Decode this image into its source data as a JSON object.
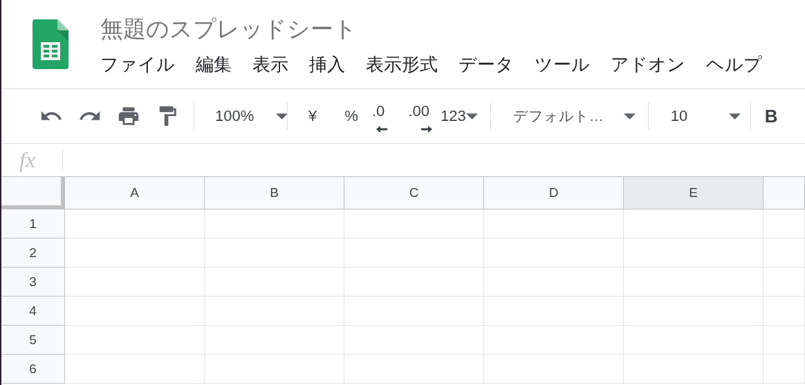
{
  "document": {
    "title": "無題のスプレッドシート"
  },
  "menu": [
    "ファイル",
    "編集",
    "表示",
    "挿入",
    "表示形式",
    "データ",
    "ツール",
    "アドオン",
    "ヘルプ"
  ],
  "toolbar": {
    "zoom": "100%",
    "currency": "¥",
    "percent": "%",
    "decimal_decrease": ".0",
    "decimal_increase": ".00",
    "more_formats": "123",
    "font": "デフォルト…",
    "font_size": "10",
    "bold": "B"
  },
  "formula_bar": {
    "label": "fx"
  },
  "grid": {
    "columns": [
      {
        "label": "A",
        "selected": false
      },
      {
        "label": "B",
        "selected": false
      },
      {
        "label": "C",
        "selected": false
      },
      {
        "label": "D",
        "selected": false
      },
      {
        "label": "E",
        "selected": true
      }
    ],
    "rows": [
      "1",
      "2",
      "3",
      "4",
      "5",
      "6"
    ]
  }
}
